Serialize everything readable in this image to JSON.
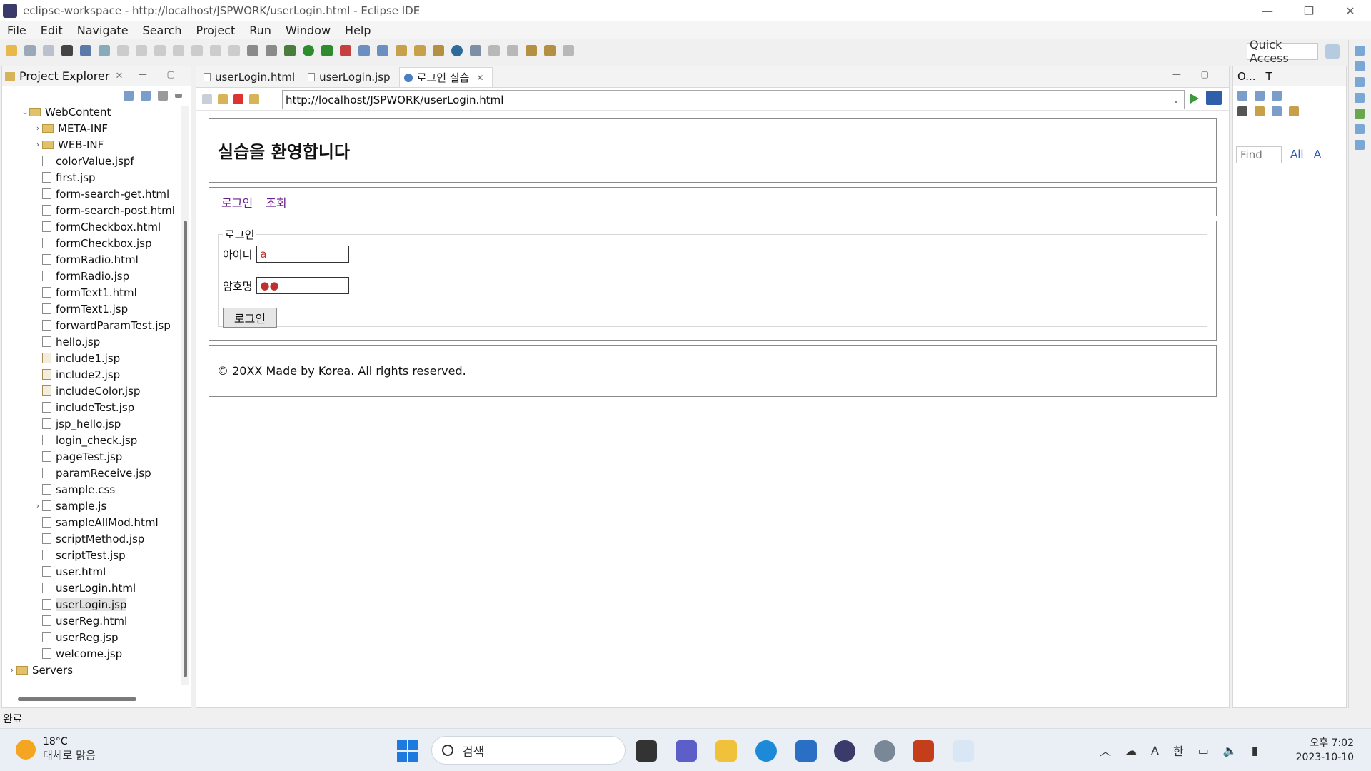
{
  "window": {
    "title": "eclipse-workspace - http://localhost/JSPWORK/userLogin.html - Eclipse IDE",
    "controls": [
      "—",
      "❐",
      "✕"
    ]
  },
  "menu": [
    "File",
    "Edit",
    "Navigate",
    "Search",
    "Project",
    "Run",
    "Window",
    "Help"
  ],
  "toolbar": {
    "quick_access": "Quick Access"
  },
  "project_explorer": {
    "title": "Project Explorer",
    "close": "✕",
    "items": [
      {
        "label": "WebContent",
        "type": "folder",
        "arrow": "⌄",
        "indent": 1
      },
      {
        "label": "META-INF",
        "type": "folder",
        "arrow": "›",
        "indent": 2
      },
      {
        "label": "WEB-INF",
        "type": "folder",
        "arrow": "›",
        "indent": 2
      },
      {
        "label": "colorValue.jspf",
        "type": "file",
        "indent": 2
      },
      {
        "label": "first.jsp",
        "type": "file",
        "indent": 2
      },
      {
        "label": "form-search-get.html",
        "type": "file",
        "indent": 2
      },
      {
        "label": "form-search-post.html",
        "type": "file",
        "indent": 2
      },
      {
        "label": "formCheckbox.html",
        "type": "file",
        "indent": 2
      },
      {
        "label": "formCheckbox.jsp",
        "type": "file",
        "indent": 2
      },
      {
        "label": "formRadio.html",
        "type": "file",
        "indent": 2
      },
      {
        "label": "formRadio.jsp",
        "type": "file",
        "indent": 2
      },
      {
        "label": "formText1.html",
        "type": "file",
        "indent": 2
      },
      {
        "label": "formText1.jsp",
        "type": "file",
        "indent": 2
      },
      {
        "label": "forwardParamTest.jsp",
        "type": "file",
        "indent": 2
      },
      {
        "label": "hello.jsp",
        "type": "file",
        "indent": 2
      },
      {
        "label": "include1.jsp",
        "type": "jsp",
        "indent": 2
      },
      {
        "label": "include2.jsp",
        "type": "jsp",
        "indent": 2
      },
      {
        "label": "includeColor.jsp",
        "type": "jsp",
        "indent": 2
      },
      {
        "label": "includeTest.jsp",
        "type": "file",
        "indent": 2
      },
      {
        "label": "jsp_hello.jsp",
        "type": "file",
        "indent": 2
      },
      {
        "label": "login_check.jsp",
        "type": "file",
        "indent": 2
      },
      {
        "label": "pageTest.jsp",
        "type": "file",
        "indent": 2
      },
      {
        "label": "paramReceive.jsp",
        "type": "file",
        "indent": 2
      },
      {
        "label": "sample.css",
        "type": "file",
        "indent": 2
      },
      {
        "label": "sample.js",
        "type": "file",
        "arrow": "›",
        "indent": 2
      },
      {
        "label": "sampleAllMod.html",
        "type": "file",
        "indent": 2
      },
      {
        "label": "scriptMethod.jsp",
        "type": "file",
        "indent": 2
      },
      {
        "label": "scriptTest.jsp",
        "type": "file",
        "indent": 2
      },
      {
        "label": "user.html",
        "type": "file",
        "indent": 2
      },
      {
        "label": "userLogin.html",
        "type": "file",
        "indent": 2
      },
      {
        "label": "userLogin.jsp",
        "type": "file",
        "indent": 2,
        "selected": true
      },
      {
        "label": "userReg.html",
        "type": "file",
        "indent": 2
      },
      {
        "label": "userReg.jsp",
        "type": "file",
        "indent": 2
      },
      {
        "label": "welcome.jsp",
        "type": "file",
        "indent": 2
      },
      {
        "label": "Servers",
        "type": "folder",
        "arrow": "›",
        "indent": 0
      }
    ]
  },
  "editor": {
    "tabs": [
      {
        "label": "userLogin.html",
        "kind": "file"
      },
      {
        "label": "userLogin.jsp",
        "kind": "file"
      },
      {
        "label": "로그인 실습",
        "kind": "browser",
        "active": true,
        "close": "✕"
      }
    ],
    "url": "http://localhost/JSPWORK/userLogin.html"
  },
  "webpage": {
    "heading": "실습을 환영합니다",
    "nav_links": [
      "로그인",
      "조회"
    ],
    "legend": "로그인",
    "id_label": "아이디",
    "id_value": "a",
    "pw_label": "암호명",
    "pw_value": "●●",
    "submit": "로그인",
    "footer": "© 20XX Made by Korea. All rights reserved."
  },
  "outline": {
    "tabs": [
      "O...",
      "T"
    ],
    "find_placeholder": "Find",
    "links": [
      "All",
      "A"
    ]
  },
  "status": {
    "text": "완료"
  },
  "taskbar": {
    "temp": "18°C",
    "weather": "대체로 맑음",
    "search": "검색",
    "tray_lang": "한",
    "tray_font": "A",
    "time": "오후 7:02",
    "date": "2023-10-10"
  },
  "colors": {
    "link_visited": "#6b1f8a",
    "accent_blue": "#1f7ae0",
    "input_text_red": "#c03030"
  }
}
